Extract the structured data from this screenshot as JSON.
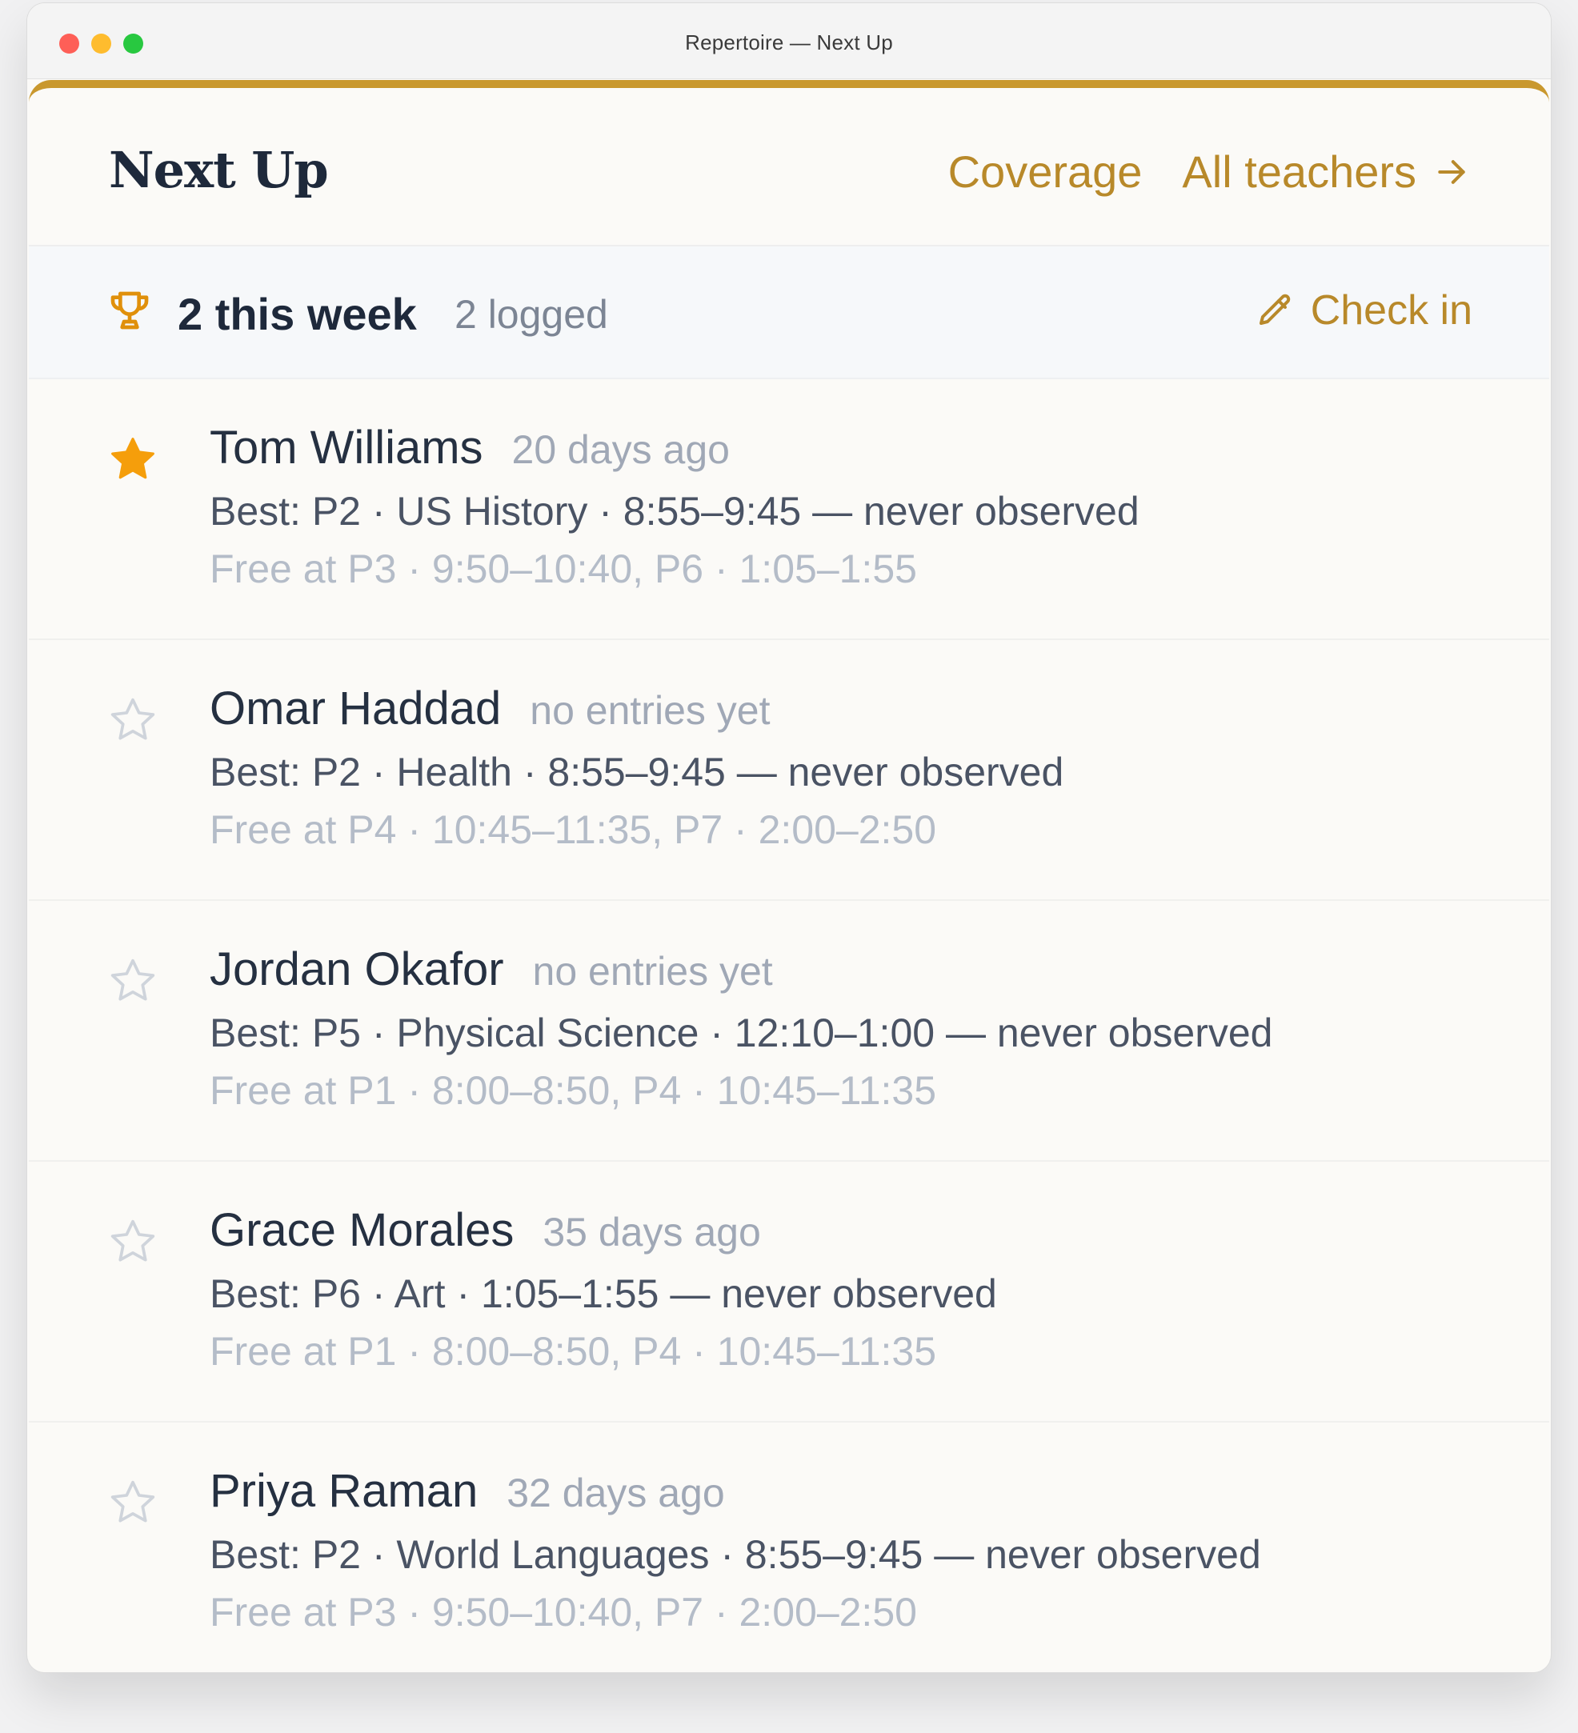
{
  "window": {
    "title": "Repertoire — Next Up"
  },
  "header": {
    "title": "Next Up",
    "coverage_label": "Coverage",
    "all_teachers_label": "All teachers"
  },
  "stats": {
    "main": "2 this week",
    "sub": "2 logged",
    "checkin_label": "Check in"
  },
  "colors": {
    "accent": "#c9982e",
    "star_filled": "#f59e0b"
  },
  "teachers": [
    {
      "name": "Tom Williams",
      "last_seen": "20 days ago",
      "best": "Best: P2 · US History · 8:55–9:45 — never observed",
      "free": "Free at P3 · 9:50–10:40, P6 · 1:05–1:55",
      "starred": true
    },
    {
      "name": "Omar Haddad",
      "last_seen": "no entries yet",
      "best": "Best: P2 · Health · 8:55–9:45 — never observed",
      "free": "Free at P4 · 10:45–11:35, P7 · 2:00–2:50",
      "starred": false
    },
    {
      "name": "Jordan Okafor",
      "last_seen": "no entries yet",
      "best": "Best: P5 · Physical Science · 12:10–1:00 — never observed",
      "free": "Free at P1 · 8:00–8:50, P4 · 10:45–11:35",
      "starred": false
    },
    {
      "name": "Grace Morales",
      "last_seen": "35 days ago",
      "best": "Best: P6 · Art · 1:05–1:55 — never observed",
      "free": "Free at P1 · 8:00–8:50, P4 · 10:45–11:35",
      "starred": false
    },
    {
      "name": "Priya Raman",
      "last_seen": "32 days ago",
      "best": "Best: P2 · World Languages · 8:55–9:45 — never observed",
      "free": "Free at P3 · 9:50–10:40, P7 · 2:00–2:50",
      "starred": false
    }
  ]
}
